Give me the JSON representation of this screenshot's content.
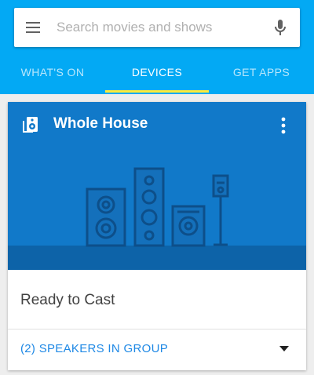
{
  "search": {
    "placeholder": "Search movies and shows",
    "value": ""
  },
  "tabs": [
    {
      "label": "WHAT'S ON",
      "active": false
    },
    {
      "label": "DEVICES",
      "active": true
    },
    {
      "label": "GET APPS",
      "active": false
    }
  ],
  "device_card": {
    "title": "Whole House",
    "status": "Ready to Cast",
    "group_label": "(2) SPEAKERS IN GROUP"
  },
  "colors": {
    "app_bar": "#03a9f4",
    "tab_indicator": "#ffeb3b",
    "hero_background": "#1179c9",
    "link": "#1e88e5"
  },
  "icons": [
    "menu-icon",
    "microphone-icon",
    "speaker-group-icon",
    "more-vert-icon",
    "dropdown-arrow-icon"
  ]
}
